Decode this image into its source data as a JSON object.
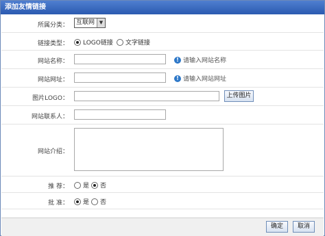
{
  "dialog": {
    "title": "添加友情链接"
  },
  "form": {
    "category": {
      "label": "所属分类：",
      "value": "互联网"
    },
    "link_type": {
      "label": "链接类型：",
      "options": [
        "LOGO链接",
        "文字链接"
      ],
      "selected": "LOGO链接"
    },
    "site_name": {
      "label": "网站名称：",
      "value": "",
      "hint": "请输入网站名称"
    },
    "site_url": {
      "label": "网站网址：",
      "value": "",
      "hint": "请输入网站网址"
    },
    "logo": {
      "label": "图片LOGO：",
      "value": "",
      "upload_button": "上传图片"
    },
    "contact": {
      "label": "网站联系人：",
      "value": ""
    },
    "intro": {
      "label": "网站介绍：",
      "value": ""
    },
    "recommend": {
      "label": "推 荐：",
      "options": [
        "是",
        "否"
      ],
      "selected": "否"
    },
    "approve": {
      "label": "批 准：",
      "options": [
        "是",
        "否"
      ],
      "selected": "是"
    }
  },
  "footer": {
    "ok_label": "确定",
    "cancel_label": "取消"
  }
}
